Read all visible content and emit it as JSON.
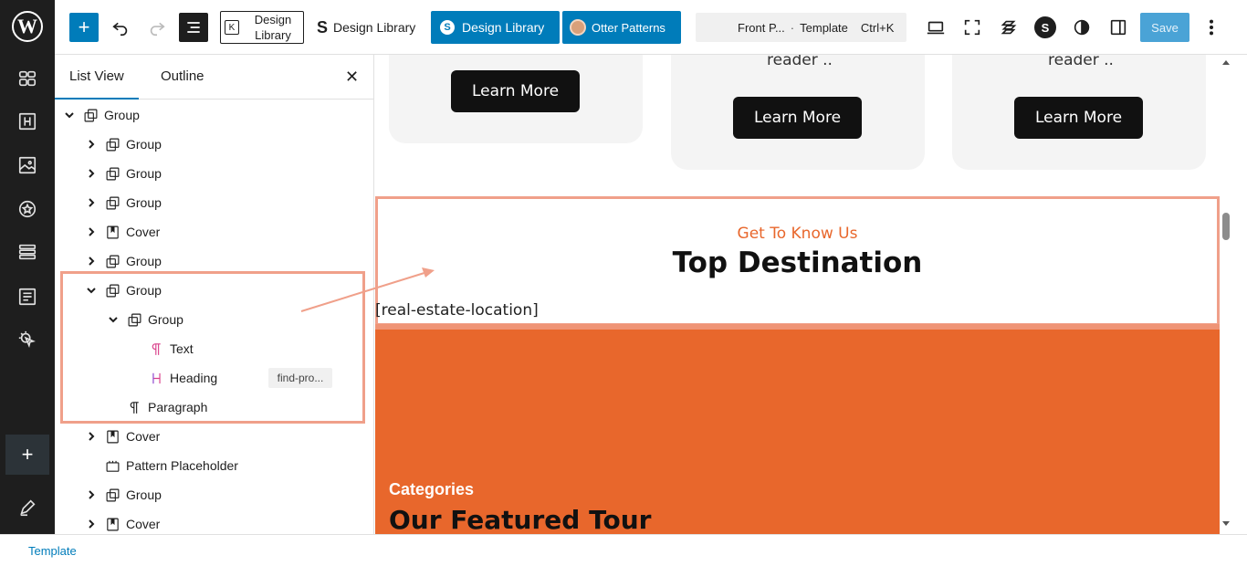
{
  "topbar": {
    "design_library_box": "Design Library",
    "design_library_plain": "Design Library",
    "design_library_blue": "Design Library",
    "otter_patterns": "Otter Patterns",
    "command": {
      "doc": "Front P...",
      "sep": "·",
      "type": "Template",
      "shortcut": "Ctrl+K"
    },
    "save_label": "Save"
  },
  "panel": {
    "tabs": [
      "List View",
      "Outline"
    ],
    "active_tab": "List View",
    "rows": [
      {
        "label": "Group",
        "icon": "group-icon",
        "level": 0,
        "expanded": true
      },
      {
        "label": "Group",
        "icon": "group-icon",
        "level": 1,
        "expanded": false
      },
      {
        "label": "Group",
        "icon": "group-icon",
        "level": 1,
        "expanded": false
      },
      {
        "label": "Group",
        "icon": "group-icon",
        "level": 1,
        "expanded": false
      },
      {
        "label": "Cover",
        "icon": "cover-icon",
        "level": 1,
        "expanded": false
      },
      {
        "label": "Group",
        "icon": "group-icon",
        "level": 1,
        "expanded": false
      },
      {
        "label": "Group",
        "icon": "group-icon",
        "level": 1,
        "expanded": true
      },
      {
        "label": "Group",
        "icon": "group-icon",
        "level": 2,
        "expanded": true
      },
      {
        "label": "Text",
        "icon": "text-icon",
        "level": 3
      },
      {
        "label": "Heading",
        "icon": "heading-icon",
        "level": 3,
        "anchor": "find-pro..."
      },
      {
        "label": "Paragraph",
        "icon": "paragraph-icon",
        "level": 2
      },
      {
        "label": "Cover",
        "icon": "cover-icon",
        "level": 1,
        "expanded": false
      },
      {
        "label": "Pattern Placeholder",
        "icon": "pattern-placeholder-icon",
        "level": 1
      },
      {
        "label": "Group",
        "icon": "group-icon",
        "level": 1,
        "expanded": false
      },
      {
        "label": "Cover",
        "icon": "cover-icon",
        "level": 1,
        "expanded": false
      }
    ]
  },
  "canvas": {
    "cards": [
      {
        "button": "Learn More"
      },
      {
        "text": "reader ..",
        "button": "Learn More"
      },
      {
        "text": "reader ..",
        "button": "Learn More"
      }
    ],
    "section": {
      "eyebrow": "Get To Know Us",
      "heading": "Top Destination",
      "shortcode": "[real-estate-location]"
    },
    "orange": {
      "categories": "Categories",
      "featured": "Our Featured Tour",
      "color": "#e8672c"
    }
  },
  "footer": {
    "breadcrumb": "Template"
  },
  "colors": {
    "accent": "#007cba",
    "highlight": "#f0a08a",
    "heading_icon": "#d93f8a"
  }
}
